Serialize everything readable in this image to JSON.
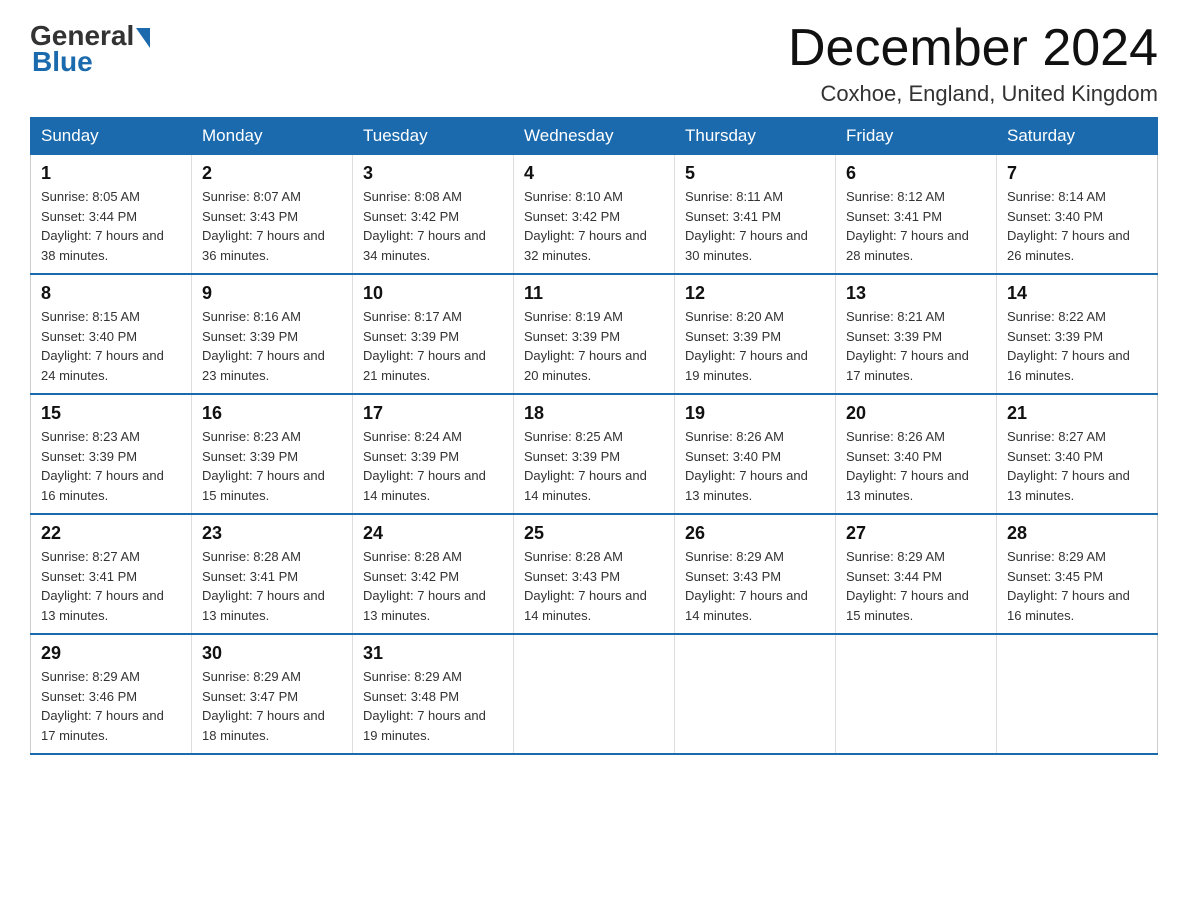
{
  "logo": {
    "general": "General",
    "blue": "Blue"
  },
  "title": "December 2024",
  "subtitle": "Coxhoe, England, United Kingdom",
  "weekdays": [
    "Sunday",
    "Monday",
    "Tuesday",
    "Wednesday",
    "Thursday",
    "Friday",
    "Saturday"
  ],
  "weeks": [
    [
      {
        "day": "1",
        "sunrise": "8:05 AM",
        "sunset": "3:44 PM",
        "daylight": "7 hours and 38 minutes."
      },
      {
        "day": "2",
        "sunrise": "8:07 AM",
        "sunset": "3:43 PM",
        "daylight": "7 hours and 36 minutes."
      },
      {
        "day": "3",
        "sunrise": "8:08 AM",
        "sunset": "3:42 PM",
        "daylight": "7 hours and 34 minutes."
      },
      {
        "day": "4",
        "sunrise": "8:10 AM",
        "sunset": "3:42 PM",
        "daylight": "7 hours and 32 minutes."
      },
      {
        "day": "5",
        "sunrise": "8:11 AM",
        "sunset": "3:41 PM",
        "daylight": "7 hours and 30 minutes."
      },
      {
        "day": "6",
        "sunrise": "8:12 AM",
        "sunset": "3:41 PM",
        "daylight": "7 hours and 28 minutes."
      },
      {
        "day": "7",
        "sunrise": "8:14 AM",
        "sunset": "3:40 PM",
        "daylight": "7 hours and 26 minutes."
      }
    ],
    [
      {
        "day": "8",
        "sunrise": "8:15 AM",
        "sunset": "3:40 PM",
        "daylight": "7 hours and 24 minutes."
      },
      {
        "day": "9",
        "sunrise": "8:16 AM",
        "sunset": "3:39 PM",
        "daylight": "7 hours and 23 minutes."
      },
      {
        "day": "10",
        "sunrise": "8:17 AM",
        "sunset": "3:39 PM",
        "daylight": "7 hours and 21 minutes."
      },
      {
        "day": "11",
        "sunrise": "8:19 AM",
        "sunset": "3:39 PM",
        "daylight": "7 hours and 20 minutes."
      },
      {
        "day": "12",
        "sunrise": "8:20 AM",
        "sunset": "3:39 PM",
        "daylight": "7 hours and 19 minutes."
      },
      {
        "day": "13",
        "sunrise": "8:21 AM",
        "sunset": "3:39 PM",
        "daylight": "7 hours and 17 minutes."
      },
      {
        "day": "14",
        "sunrise": "8:22 AM",
        "sunset": "3:39 PM",
        "daylight": "7 hours and 16 minutes."
      }
    ],
    [
      {
        "day": "15",
        "sunrise": "8:23 AM",
        "sunset": "3:39 PM",
        "daylight": "7 hours and 16 minutes."
      },
      {
        "day": "16",
        "sunrise": "8:23 AM",
        "sunset": "3:39 PM",
        "daylight": "7 hours and 15 minutes."
      },
      {
        "day": "17",
        "sunrise": "8:24 AM",
        "sunset": "3:39 PM",
        "daylight": "7 hours and 14 minutes."
      },
      {
        "day": "18",
        "sunrise": "8:25 AM",
        "sunset": "3:39 PM",
        "daylight": "7 hours and 14 minutes."
      },
      {
        "day": "19",
        "sunrise": "8:26 AM",
        "sunset": "3:40 PM",
        "daylight": "7 hours and 13 minutes."
      },
      {
        "day": "20",
        "sunrise": "8:26 AM",
        "sunset": "3:40 PM",
        "daylight": "7 hours and 13 minutes."
      },
      {
        "day": "21",
        "sunrise": "8:27 AM",
        "sunset": "3:40 PM",
        "daylight": "7 hours and 13 minutes."
      }
    ],
    [
      {
        "day": "22",
        "sunrise": "8:27 AM",
        "sunset": "3:41 PM",
        "daylight": "7 hours and 13 minutes."
      },
      {
        "day": "23",
        "sunrise": "8:28 AM",
        "sunset": "3:41 PM",
        "daylight": "7 hours and 13 minutes."
      },
      {
        "day": "24",
        "sunrise": "8:28 AM",
        "sunset": "3:42 PM",
        "daylight": "7 hours and 13 minutes."
      },
      {
        "day": "25",
        "sunrise": "8:28 AM",
        "sunset": "3:43 PM",
        "daylight": "7 hours and 14 minutes."
      },
      {
        "day": "26",
        "sunrise": "8:29 AM",
        "sunset": "3:43 PM",
        "daylight": "7 hours and 14 minutes."
      },
      {
        "day": "27",
        "sunrise": "8:29 AM",
        "sunset": "3:44 PM",
        "daylight": "7 hours and 15 minutes."
      },
      {
        "day": "28",
        "sunrise": "8:29 AM",
        "sunset": "3:45 PM",
        "daylight": "7 hours and 16 minutes."
      }
    ],
    [
      {
        "day": "29",
        "sunrise": "8:29 AM",
        "sunset": "3:46 PM",
        "daylight": "7 hours and 17 minutes."
      },
      {
        "day": "30",
        "sunrise": "8:29 AM",
        "sunset": "3:47 PM",
        "daylight": "7 hours and 18 minutes."
      },
      {
        "day": "31",
        "sunrise": "8:29 AM",
        "sunset": "3:48 PM",
        "daylight": "7 hours and 19 minutes."
      },
      null,
      null,
      null,
      null
    ]
  ]
}
